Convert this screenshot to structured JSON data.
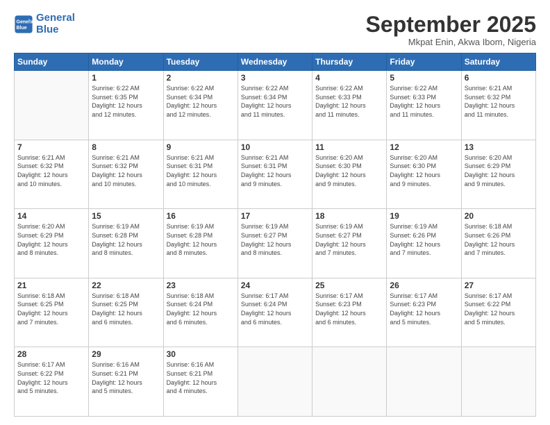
{
  "logo": {
    "line1": "General",
    "line2": "Blue"
  },
  "title": "September 2025",
  "subtitle": "Mkpat Enin, Akwa Ibom, Nigeria",
  "days_header": [
    "Sunday",
    "Monday",
    "Tuesday",
    "Wednesday",
    "Thursday",
    "Friday",
    "Saturday"
  ],
  "weeks": [
    [
      {
        "num": "",
        "info": ""
      },
      {
        "num": "1",
        "info": "Sunrise: 6:22 AM\nSunset: 6:35 PM\nDaylight: 12 hours\nand 12 minutes."
      },
      {
        "num": "2",
        "info": "Sunrise: 6:22 AM\nSunset: 6:34 PM\nDaylight: 12 hours\nand 12 minutes."
      },
      {
        "num": "3",
        "info": "Sunrise: 6:22 AM\nSunset: 6:34 PM\nDaylight: 12 hours\nand 11 minutes."
      },
      {
        "num": "4",
        "info": "Sunrise: 6:22 AM\nSunset: 6:33 PM\nDaylight: 12 hours\nand 11 minutes."
      },
      {
        "num": "5",
        "info": "Sunrise: 6:22 AM\nSunset: 6:33 PM\nDaylight: 12 hours\nand 11 minutes."
      },
      {
        "num": "6",
        "info": "Sunrise: 6:21 AM\nSunset: 6:32 PM\nDaylight: 12 hours\nand 11 minutes."
      }
    ],
    [
      {
        "num": "7",
        "info": "Sunrise: 6:21 AM\nSunset: 6:32 PM\nDaylight: 12 hours\nand 10 minutes."
      },
      {
        "num": "8",
        "info": "Sunrise: 6:21 AM\nSunset: 6:32 PM\nDaylight: 12 hours\nand 10 minutes."
      },
      {
        "num": "9",
        "info": "Sunrise: 6:21 AM\nSunset: 6:31 PM\nDaylight: 12 hours\nand 10 minutes."
      },
      {
        "num": "10",
        "info": "Sunrise: 6:21 AM\nSunset: 6:31 PM\nDaylight: 12 hours\nand 9 minutes."
      },
      {
        "num": "11",
        "info": "Sunrise: 6:20 AM\nSunset: 6:30 PM\nDaylight: 12 hours\nand 9 minutes."
      },
      {
        "num": "12",
        "info": "Sunrise: 6:20 AM\nSunset: 6:30 PM\nDaylight: 12 hours\nand 9 minutes."
      },
      {
        "num": "13",
        "info": "Sunrise: 6:20 AM\nSunset: 6:29 PM\nDaylight: 12 hours\nand 9 minutes."
      }
    ],
    [
      {
        "num": "14",
        "info": "Sunrise: 6:20 AM\nSunset: 6:29 PM\nDaylight: 12 hours\nand 8 minutes."
      },
      {
        "num": "15",
        "info": "Sunrise: 6:19 AM\nSunset: 6:28 PM\nDaylight: 12 hours\nand 8 minutes."
      },
      {
        "num": "16",
        "info": "Sunrise: 6:19 AM\nSunset: 6:28 PM\nDaylight: 12 hours\nand 8 minutes."
      },
      {
        "num": "17",
        "info": "Sunrise: 6:19 AM\nSunset: 6:27 PM\nDaylight: 12 hours\nand 8 minutes."
      },
      {
        "num": "18",
        "info": "Sunrise: 6:19 AM\nSunset: 6:27 PM\nDaylight: 12 hours\nand 7 minutes."
      },
      {
        "num": "19",
        "info": "Sunrise: 6:19 AM\nSunset: 6:26 PM\nDaylight: 12 hours\nand 7 minutes."
      },
      {
        "num": "20",
        "info": "Sunrise: 6:18 AM\nSunset: 6:26 PM\nDaylight: 12 hours\nand 7 minutes."
      }
    ],
    [
      {
        "num": "21",
        "info": "Sunrise: 6:18 AM\nSunset: 6:25 PM\nDaylight: 12 hours\nand 7 minutes."
      },
      {
        "num": "22",
        "info": "Sunrise: 6:18 AM\nSunset: 6:25 PM\nDaylight: 12 hours\nand 6 minutes."
      },
      {
        "num": "23",
        "info": "Sunrise: 6:18 AM\nSunset: 6:24 PM\nDaylight: 12 hours\nand 6 minutes."
      },
      {
        "num": "24",
        "info": "Sunrise: 6:17 AM\nSunset: 6:24 PM\nDaylight: 12 hours\nand 6 minutes."
      },
      {
        "num": "25",
        "info": "Sunrise: 6:17 AM\nSunset: 6:23 PM\nDaylight: 12 hours\nand 6 minutes."
      },
      {
        "num": "26",
        "info": "Sunrise: 6:17 AM\nSunset: 6:23 PM\nDaylight: 12 hours\nand 5 minutes."
      },
      {
        "num": "27",
        "info": "Sunrise: 6:17 AM\nSunset: 6:22 PM\nDaylight: 12 hours\nand 5 minutes."
      }
    ],
    [
      {
        "num": "28",
        "info": "Sunrise: 6:17 AM\nSunset: 6:22 PM\nDaylight: 12 hours\nand 5 minutes."
      },
      {
        "num": "29",
        "info": "Sunrise: 6:16 AM\nSunset: 6:21 PM\nDaylight: 12 hours\nand 5 minutes."
      },
      {
        "num": "30",
        "info": "Sunrise: 6:16 AM\nSunset: 6:21 PM\nDaylight: 12 hours\nand 4 minutes."
      },
      {
        "num": "",
        "info": ""
      },
      {
        "num": "",
        "info": ""
      },
      {
        "num": "",
        "info": ""
      },
      {
        "num": "",
        "info": ""
      }
    ]
  ]
}
